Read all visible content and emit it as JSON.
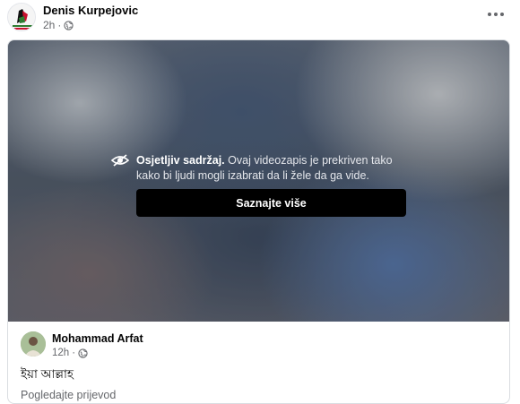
{
  "post": {
    "author": "Denis Kurpejovic",
    "time": "2h",
    "separator": "·",
    "privacy_icon": "globe-icon",
    "more_icon": "more-horizontal-icon"
  },
  "shared": {
    "video": {
      "warning_title": "Osjetljiv sadržaj.",
      "warning_body": "Ovaj videozapis je prekriven tako kako bi ljudi mogli izabrati da li žele da ga vide.",
      "button_label": "Saznajte više",
      "icon": "eye-crossed-icon"
    },
    "comment": {
      "author": "Mohammad Arfat",
      "time": "12h",
      "separator": "·",
      "privacy_icon": "globe-icon",
      "text": "ইয়া আল্লাহ",
      "translate_label": "Pogledajte prijevod"
    }
  }
}
